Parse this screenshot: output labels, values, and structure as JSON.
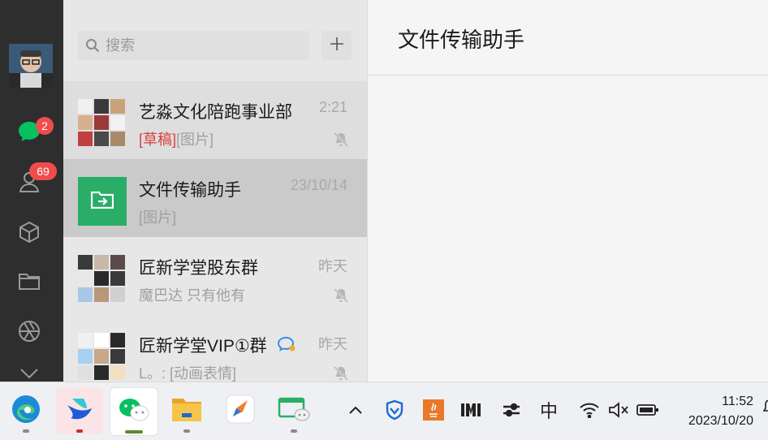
{
  "sidebar": {
    "chat_badge": "2",
    "contacts_badge": "69"
  },
  "search": {
    "placeholder": "搜索"
  },
  "chats": [
    {
      "name": "艺淼文化陪跑事业部",
      "time": "2:21",
      "draft_tag": "[草稿]",
      "preview": "[图片]",
      "muted": true
    },
    {
      "name": "文件传输助手",
      "time": "23/10/14",
      "preview": "[图片]",
      "muted": false,
      "selected": true
    },
    {
      "name": "匠新学堂股东群",
      "time": "昨天",
      "preview": "魔巴达 只有他有",
      "muted": true
    },
    {
      "name": "匠新学堂VIP①群",
      "time": "昨天",
      "preview": "L。: [动画表情]",
      "muted": true
    }
  ],
  "main": {
    "title": "文件传输助手"
  },
  "taskbar": {
    "apps": [
      "edge-icon",
      "feishu-icon",
      "wechat-icon",
      "file-explorer-icon",
      "pen-icon",
      "wechat-window-icon"
    ],
    "tray": {
      "ime": "中"
    },
    "time": "11:52",
    "date": "2023/10/20"
  },
  "colors": {
    "accent": "#07c160",
    "badge": "#f04c4c",
    "file_helper": "#2aae67",
    "draft": "#d94040"
  }
}
